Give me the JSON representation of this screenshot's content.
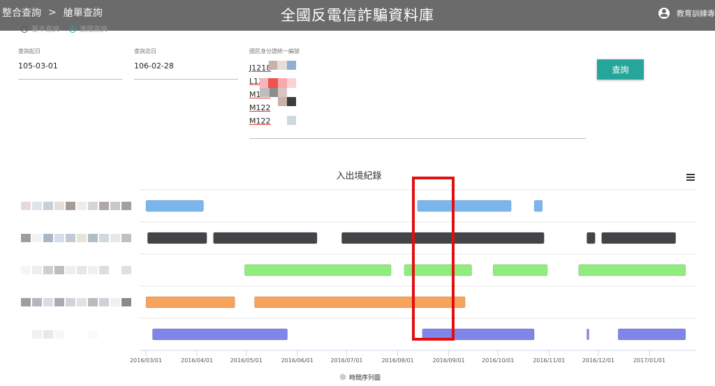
{
  "header": {
    "breadcrumb": [
      "整合查詢",
      "艙單查詢"
    ],
    "separator": ">",
    "app_title": "全國反電信詐騙資料庫",
    "user_name": "教育訓練專"
  },
  "modes": [
    "基本查詢",
    "進階查詢"
  ],
  "form": {
    "start_label": "查詢起日",
    "start_value": "105-03-01",
    "end_label": "查詢迄日",
    "end_value": "106-02-28",
    "id_label": "國民身分證統一編號",
    "ids": [
      "J1218",
      "L1230",
      "M122",
      "M122",
      "M122"
    ],
    "submit_label": "查詢"
  },
  "colors": {
    "accent": "#26a69a",
    "highlight": "#e01010"
  },
  "chart_data": {
    "type": "timeline",
    "title": "入出境紀錄",
    "legend": "時間序列圖",
    "x_ticks": [
      "2016/03/01",
      "2016/04/01",
      "2016/05/01",
      "2016/06/01",
      "2016/07/01",
      "2016/08/01",
      "2016/09/01",
      "2016/10/01",
      "2016/11/01",
      "2016/12/01",
      "2017/01/01"
    ],
    "rows": [
      {
        "color": "#7cb5ec",
        "bars": [
          [
            "2016-03-01",
            "2016-04-05"
          ],
          [
            "2016-08-13",
            "2016-10-09"
          ],
          [
            "2016-10-23",
            "2016-10-28"
          ]
        ]
      },
      {
        "color": "#434348",
        "bars": [
          [
            "2016-03-02",
            "2016-04-07"
          ],
          [
            "2016-04-11",
            "2016-06-13"
          ],
          [
            "2016-06-28",
            "2016-10-29"
          ],
          [
            "2016-11-24",
            "2016-11-29"
          ],
          [
            "2016-12-03",
            "2017-01-17"
          ]
        ]
      },
      {
        "color": "#90ed7d",
        "bars": [
          [
            "2016-04-30",
            "2016-07-28"
          ],
          [
            "2016-08-05",
            "2016-09-15"
          ],
          [
            "2016-09-28",
            "2016-10-31"
          ],
          [
            "2016-11-19",
            "2017-01-23"
          ]
        ]
      },
      {
        "color": "#f7a35c",
        "bars": [
          [
            "2016-03-01",
            "2016-04-24"
          ],
          [
            "2016-05-06",
            "2016-09-11"
          ]
        ]
      },
      {
        "color": "#8085e9",
        "bars": [
          [
            "2016-03-05",
            "2016-05-26"
          ],
          [
            "2016-08-16",
            "2016-10-23"
          ],
          [
            "2016-11-24",
            "2016-11-25"
          ],
          [
            "2016-12-13",
            "2017-01-23"
          ]
        ]
      }
    ],
    "highlight": {
      "from": "2016-08-13",
      "to": "2016-09-11"
    }
  }
}
